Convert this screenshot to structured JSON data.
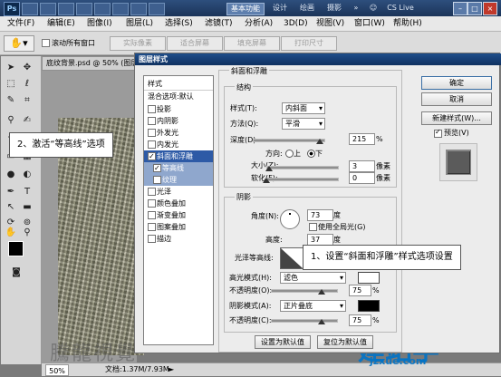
{
  "titlebar": {
    "logo": "Ps",
    "workspace_active": "基本功能",
    "workspace_items": [
      "设计",
      "绘画",
      "摄影"
    ],
    "cslive": "CS Live"
  },
  "menubar": {
    "items": [
      "文件(F)",
      "编辑(E)",
      "图像(I)",
      "图层(L)",
      "选择(S)",
      "滤镜(T)",
      "分析(A)",
      "3D(D)",
      "视图(V)",
      "窗口(W)",
      "帮助(H)"
    ]
  },
  "options": {
    "scroll_all_windows": "滚动所有窗口",
    "buttons": [
      "实际像素",
      "适合屏幕",
      "填充屏幕",
      "打印尺寸"
    ]
  },
  "document": {
    "tab_title": "底纹背景.psd @ 50% (图层",
    "zoom": "50%",
    "doc_size": "文档:1.37M/7.93M",
    "watermark_left": "騰龍視覺",
    "watermark_url": "www.",
    "watermark_right": "建站学",
    "watermark_right_url": "jzxue.com"
  },
  "dialog": {
    "title": "图层样式",
    "style_list": {
      "header": "样式",
      "blend_options": "混合选项:默认",
      "items": [
        {
          "label": "投影",
          "checked": false
        },
        {
          "label": "内阴影",
          "checked": false
        },
        {
          "label": "外发光",
          "checked": false
        },
        {
          "label": "内发光",
          "checked": false
        },
        {
          "label": "斜面和浮雕",
          "checked": true
        },
        {
          "label": "等高线",
          "checked": true
        },
        {
          "label": "纹理",
          "checked": false
        },
        {
          "label": "光泽",
          "checked": false
        },
        {
          "label": "颜色叠加",
          "checked": false
        },
        {
          "label": "渐变叠加",
          "checked": false
        },
        {
          "label": "图案叠加",
          "checked": false
        },
        {
          "label": "描边",
          "checked": false
        }
      ]
    },
    "bevel": {
      "group_title": "斜面和浮雕",
      "structure_title": "结构",
      "style_label": "样式(T):",
      "style_value": "内斜面",
      "method_label": "方法(Q):",
      "method_value": "平滑",
      "depth_label": "深度(D):",
      "depth_value": "215",
      "depth_unit": "%",
      "direction_label": "方向:",
      "direction_up": "上",
      "direction_down": "下",
      "size_label": "大小(Z):",
      "size_value": "3",
      "size_unit": "像素",
      "soften_label": "软化(F):",
      "soften_value": "0",
      "soften_unit": "像素"
    },
    "shading": {
      "title": "阴影",
      "angle_label": "角度(N):",
      "angle_value": "73",
      "angle_unit": "度",
      "global_light": "使用全局光(G)",
      "altitude_label": "高度:",
      "altitude_value": "37",
      "altitude_unit": "度",
      "gloss_label": "光泽等高线:",
      "highlight_mode_label": "高光模式(H):",
      "highlight_mode_value": "滤色",
      "highlight_opacity_label": "不透明度(O):",
      "highlight_opacity_value": "75",
      "shadow_mode_label": "阴影模式(A):",
      "shadow_mode_value": "正片叠底",
      "shadow_opacity_label": "不透明度(C):",
      "shadow_opacity_value": "75",
      "opacity_unit": "%"
    },
    "buttons": {
      "ok": "确定",
      "cancel": "取消",
      "new_style": "新建样式(W)...",
      "preview": "预览(V)",
      "set_default": "设置为默认值",
      "reset_default": "复位为默认值"
    }
  },
  "callouts": {
    "step1": "1、设置“斜面和浮雕”样式选项设置",
    "step2": "2、激活“等高线”选项"
  },
  "colors": {
    "dialog_title": "#1f4d8a",
    "selected_item": "#2d5aa6",
    "sub_item": "#8fa7cd"
  }
}
